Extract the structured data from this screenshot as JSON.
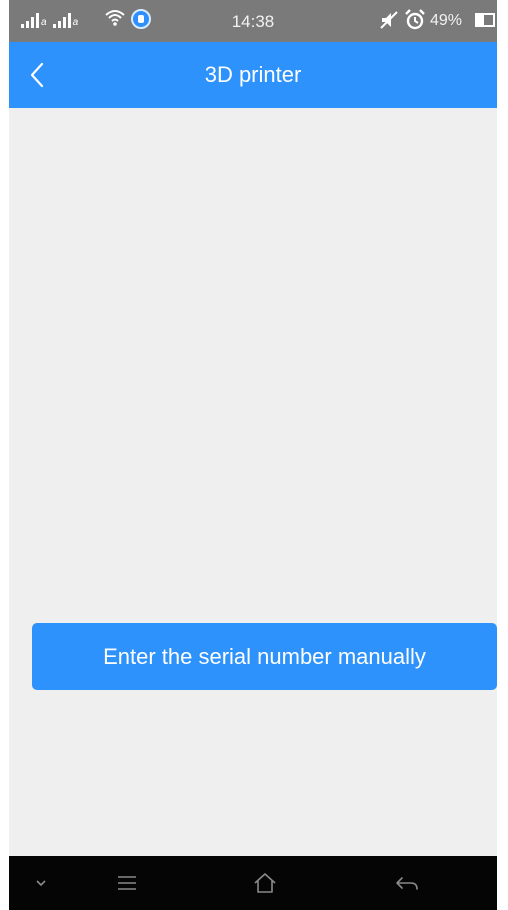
{
  "status_bar": {
    "time": "14:38",
    "battery_percent": "49%",
    "battery_level": 0.49,
    "network_labels": [
      "a",
      "a"
    ],
    "icons": [
      "signal-icon",
      "wifi-icon",
      "vpn-icon",
      "mute-icon",
      "alarm-icon",
      "battery-icon"
    ]
  },
  "app_bar": {
    "title": "3D printer",
    "back_icon": "chevron-left-icon"
  },
  "main": {
    "manual_entry_label": "Enter the serial number manually"
  },
  "nav_bar": {
    "items": [
      "chevron-down-icon",
      "menu-icon",
      "home-icon",
      "back-arrow-icon"
    ]
  },
  "colors": {
    "accent": "#2d92fb",
    "background": "#efefef",
    "status_bar": "#7a7a7a",
    "nav_bar": "#050505"
  }
}
